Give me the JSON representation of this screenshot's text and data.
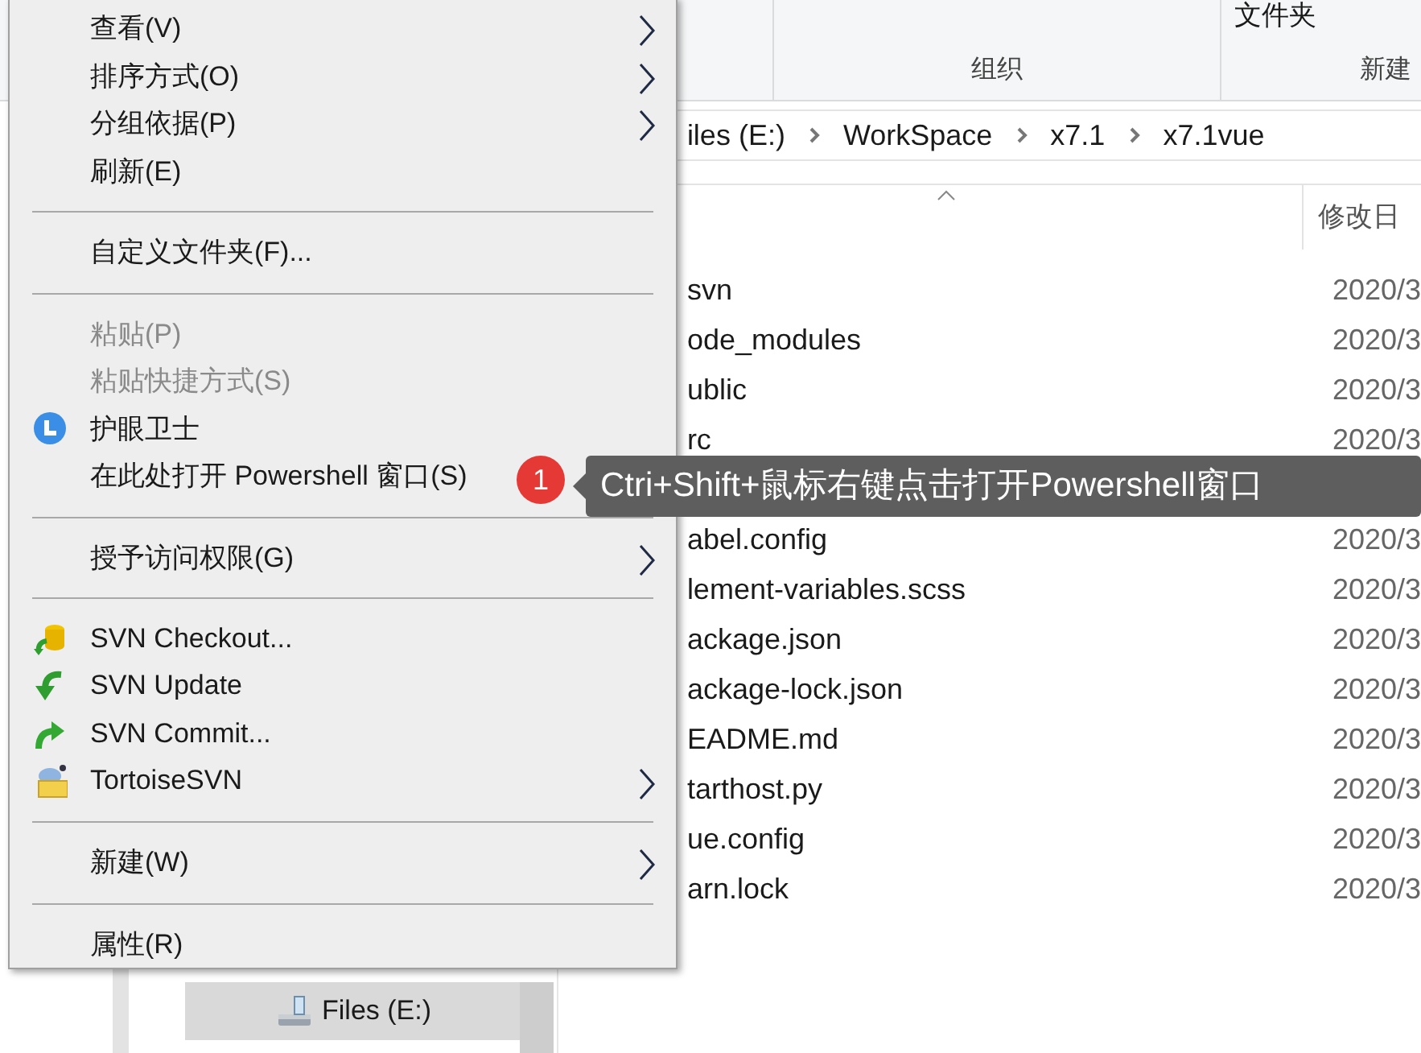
{
  "ribbon": {
    "partial_label": "文件夹",
    "groups": [
      "组织",
      "新建"
    ]
  },
  "breadcrumb": [
    "iles (E:)",
    "WorkSpace",
    "x7.1",
    "x7.1vue"
  ],
  "table": {
    "columns": [
      "修改日"
    ],
    "rows": [
      {
        "name": "svn",
        "date": "2020/3"
      },
      {
        "name": "ode_modules",
        "date": "2020/3"
      },
      {
        "name": "ublic",
        "date": "2020/3"
      },
      {
        "name": "rc",
        "date": "2020/3"
      },
      {
        "name": "abel.config",
        "date": "2020/3"
      },
      {
        "name": "lement-variables.scss",
        "date": "2020/3"
      },
      {
        "name": "ackage.json",
        "date": "2020/3"
      },
      {
        "name": "ackage-lock.json",
        "date": "2020/3"
      },
      {
        "name": "EADME.md",
        "date": "2020/3"
      },
      {
        "name": "tarthost.py",
        "date": "2020/3"
      },
      {
        "name": "ue.config",
        "date": "2020/3"
      },
      {
        "name": "arn.lock",
        "date": "2020/3"
      }
    ]
  },
  "nav_pane": {
    "items": [
      {
        "label": "Files (E:)",
        "selected": true
      }
    ]
  },
  "context_menu": {
    "sections": [
      [
        {
          "label": "查看(V)",
          "submenu": true,
          "disabled": false
        },
        {
          "label": "排序方式(O)",
          "submenu": true,
          "disabled": false
        },
        {
          "label": "分组依据(P)",
          "submenu": true,
          "disabled": false
        },
        {
          "label": "刷新(E)",
          "submenu": false,
          "disabled": false
        }
      ],
      [
        {
          "label": "自定义文件夹(F)...",
          "submenu": false,
          "disabled": false
        }
      ],
      [
        {
          "label": "粘贴(P)",
          "submenu": false,
          "disabled": true
        },
        {
          "label": "粘贴快捷方式(S)",
          "submenu": false,
          "disabled": true
        },
        {
          "label": "护眼卫士",
          "submenu": false,
          "disabled": false
        },
        {
          "label": "在此处打开 Powershell 窗口(S)",
          "submenu": false,
          "disabled": false,
          "badge": "1"
        }
      ],
      [
        {
          "label": "授予访问权限(G)",
          "submenu": true,
          "disabled": false
        }
      ],
      [
        {
          "label": "SVN Checkout...",
          "submenu": false,
          "disabled": false
        },
        {
          "label": "SVN Update",
          "submenu": false,
          "disabled": false
        },
        {
          "label": "SVN Commit...",
          "submenu": false,
          "disabled": false
        },
        {
          "label": "TortoiseSVN",
          "submenu": true,
          "disabled": false
        }
      ],
      [
        {
          "label": "新建(W)",
          "submenu": true,
          "disabled": false
        }
      ],
      [
        {
          "label": "属性(R)",
          "submenu": false,
          "disabled": false
        }
      ]
    ]
  },
  "tooltip": {
    "text": "Ctri+Shift+鼠标右键点击打开Powershell窗口"
  }
}
